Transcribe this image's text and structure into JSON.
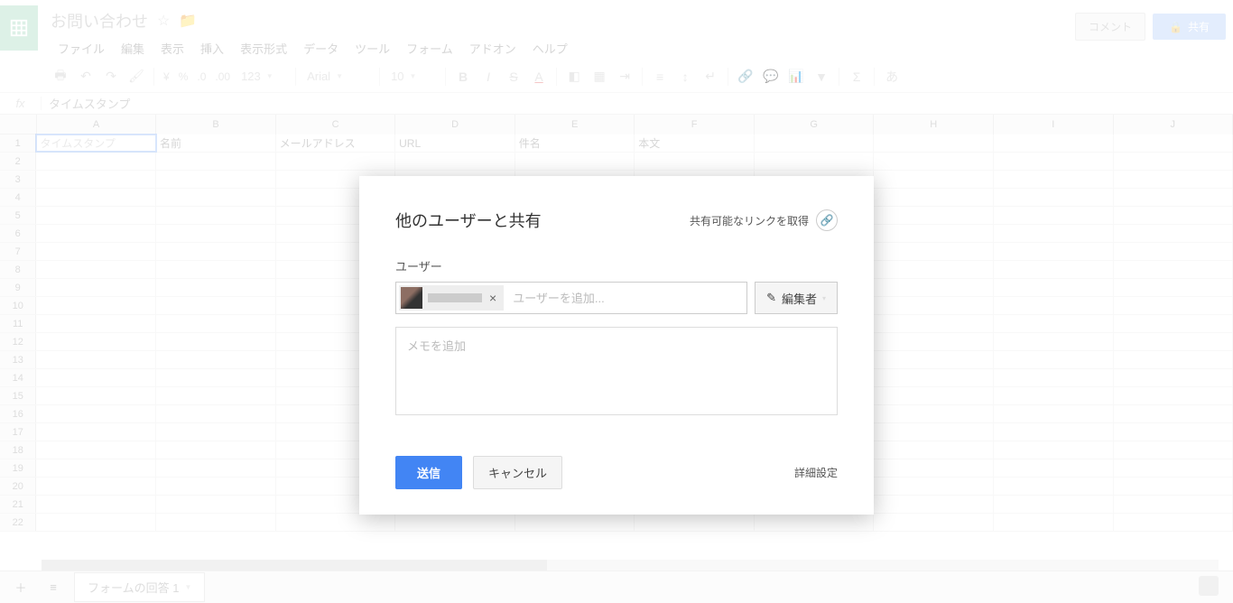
{
  "doc": {
    "title": "お問い合わせ"
  },
  "menu": [
    "ファイル",
    "編集",
    "表示",
    "挿入",
    "表示形式",
    "データ",
    "ツール",
    "フォーム",
    "アドオン",
    "ヘルプ"
  ],
  "header_buttons": {
    "comment": "コメント",
    "share": "共有"
  },
  "toolbar": {
    "font": "Arial",
    "fontSize": "10",
    "currency": "¥",
    "percent": "%",
    "dec1": ".0",
    "dec2": ".00",
    "num": "123"
  },
  "formula": {
    "value": "タイムスタンプ"
  },
  "columns": [
    "A",
    "B",
    "C",
    "D",
    "E",
    "F",
    "G",
    "H",
    "I",
    "J"
  ],
  "row1": [
    "タイムスタンプ",
    "名前",
    "メールアドレス",
    "URL",
    "件名",
    "本文",
    "",
    "",
    "",
    ""
  ],
  "rowCount": 22,
  "sheet": {
    "tab": "フォームの回答 1"
  },
  "modal": {
    "title": "他のユーザーと共有",
    "linkText": "共有可能なリンクを取得",
    "usersLabel": "ユーザー",
    "inputPlaceholder": "ユーザーを追加...",
    "roleLabel": "編集者",
    "memoPlaceholder": "メモを追加",
    "send": "送信",
    "cancel": "キャンセル",
    "advanced": "詳細設定"
  }
}
